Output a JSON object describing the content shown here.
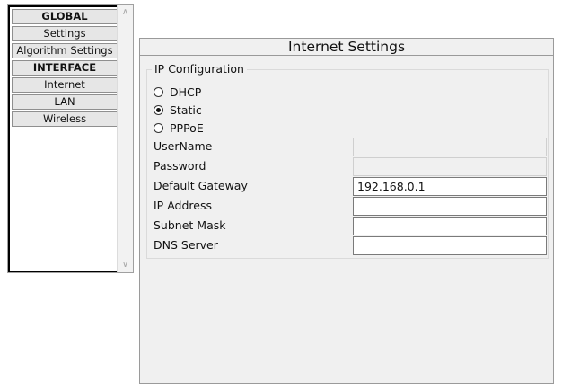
{
  "nav": {
    "items": [
      {
        "label": "GLOBAL",
        "header": true
      },
      {
        "label": "Settings",
        "header": false
      },
      {
        "label": "Algorithm Settings",
        "header": false
      },
      {
        "label": "INTERFACE",
        "header": true
      },
      {
        "label": "Internet",
        "header": false
      },
      {
        "label": "LAN",
        "header": false
      },
      {
        "label": "Wireless",
        "header": false
      }
    ],
    "scroll_up_icon": "scroll-up-arrow",
    "scroll_down_icon": "scroll-down-arrow"
  },
  "panel": {
    "title": "Internet Settings",
    "group_title": "IP Configuration",
    "radios": [
      {
        "label": "DHCP",
        "checked": false
      },
      {
        "label": "Static",
        "checked": true
      },
      {
        "label": "PPPoE",
        "checked": false
      }
    ],
    "fields": {
      "username": {
        "label": "UserName",
        "value": ""
      },
      "password": {
        "label": "Password",
        "value": ""
      },
      "default_gateway": {
        "label": "Default Gateway",
        "value": "192.168.0.1"
      },
      "ip_address": {
        "label": "IP Address",
        "value": ""
      },
      "subnet_mask": {
        "label": "Subnet Mask",
        "value": ""
      },
      "dns_server": {
        "label": "DNS Server",
        "value": ""
      }
    }
  }
}
